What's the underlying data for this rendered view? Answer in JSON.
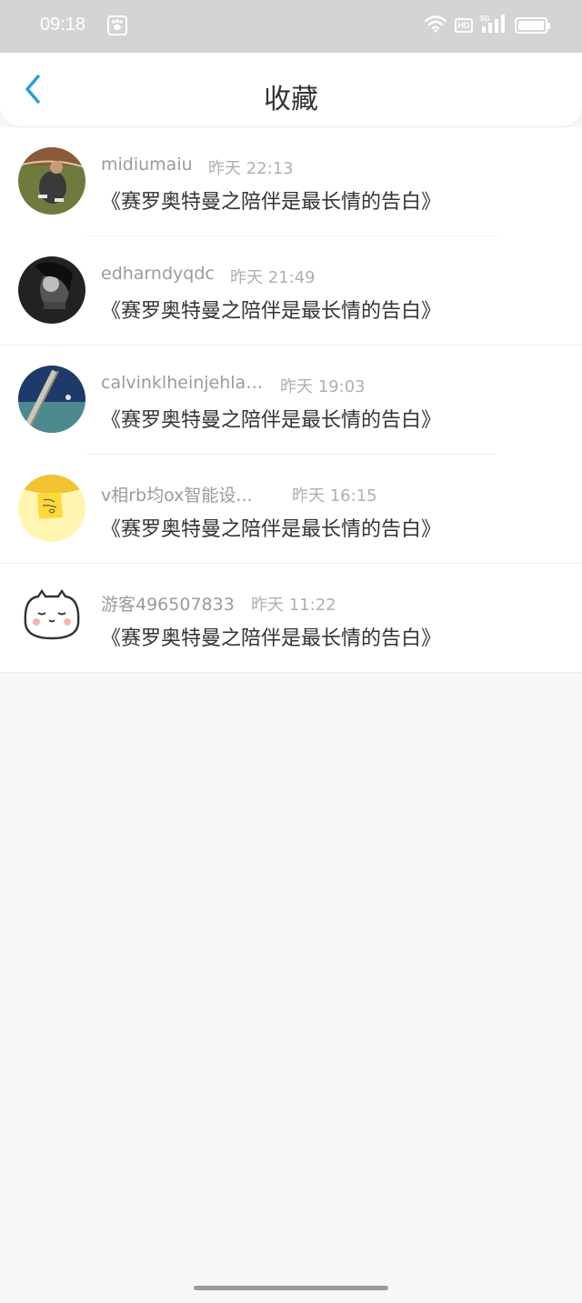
{
  "status_bar": {
    "time": "09:18",
    "icons": [
      "baidu-paw-icon",
      "wifi-icon",
      "hd-icon",
      "signal-5g-icon",
      "battery-icon"
    ],
    "hd_label": "HD",
    "network_label": "5G"
  },
  "header": {
    "title": "收藏",
    "back_icon": "chevron-left-icon",
    "accent_color": "#2a9be0"
  },
  "favorites": [
    {
      "user": "midiumaiu",
      "time": "昨天 22:13",
      "title": "《赛罗奥特曼之陪伴是最长情的告白》",
      "avatar": "person-sitting-photo"
    },
    {
      "user": "edharndyqdc",
      "time": "昨天 21:49",
      "title": "《赛罗奥特曼之陪伴是最长情的告白》",
      "avatar": "bw-portrait-photo"
    },
    {
      "user": "calvinklheinjehlans",
      "time": "昨天 19:03",
      "title": "《赛罗奥特曼之陪伴是最长情的告白》",
      "avatar": "fence-photo"
    },
    {
      "user": "v相rb均ox智能设...",
      "time": "昨天 16:15",
      "title": "《赛罗奥特曼之陪伴是最长情的告白》",
      "avatar": "sticky-note-photo"
    },
    {
      "user": "游客496507833",
      "time": "昨天 11:22",
      "title": "《赛罗奥特曼之陪伴是最长情的告白》",
      "avatar": "cartoon-face"
    }
  ],
  "colors": {
    "status_bar_bg": "#d4d4d4",
    "page_bg": "#f8f7f8",
    "username": "#9b9b9b",
    "timestamp": "#b0b0b0",
    "title_text": "#333333"
  }
}
